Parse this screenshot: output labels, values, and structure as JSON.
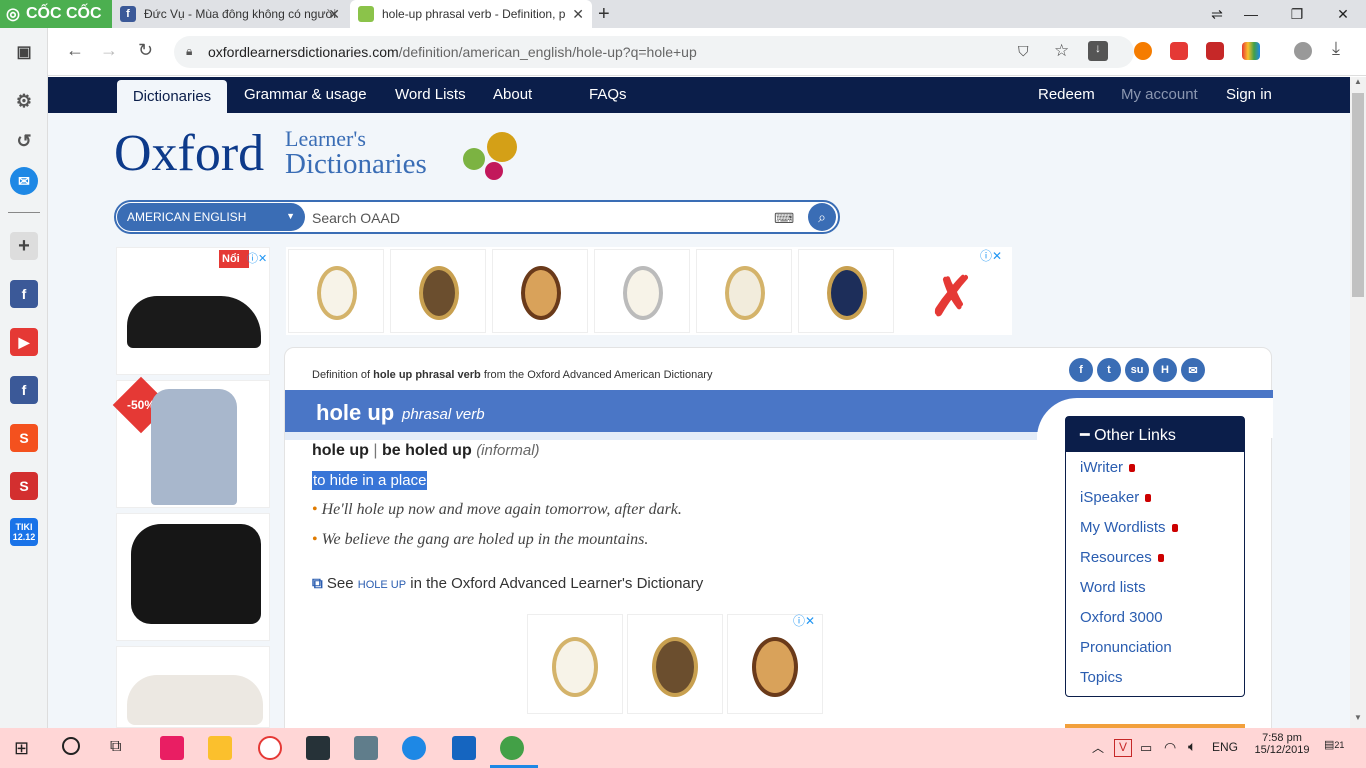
{
  "browser": {
    "brand": "CỐC CỐC",
    "tabs": [
      {
        "title": "Đức Vụ - Mùa đông không có người"
      },
      {
        "title": "hole-up phrasal verb - Definition, p"
      }
    ],
    "new_tab": "+",
    "url_host": "oxfordlearnersdictionaries.com",
    "url_path": "/definition/american_english/hole-up?q=hole+up"
  },
  "site": {
    "nav": [
      "Dictionaries",
      "Grammar & usage",
      "Word Lists",
      "About",
      "FAQs"
    ],
    "nav_right": [
      "Redeem",
      "My account",
      "Sign in"
    ],
    "logo_main": "Oxford",
    "logo_top": "Learner's",
    "logo_bottom": "Dictionaries",
    "search": {
      "dialect": "AMERICAN ENGLISH",
      "placeholder": "Search OAAD"
    }
  },
  "ads": {
    "left_badges": [
      "Nổi",
      "-50%"
    ]
  },
  "entry": {
    "breadcrumb_pre": "Definition of",
    "breadcrumb_term": "hole up phrasal verb",
    "breadcrumb_post": "from the Oxford Advanced American Dictionary",
    "headword": "hole up",
    "pos": "phrasal verb",
    "forms_a": "hole up",
    "forms_sep": "|",
    "forms_b": "be holed up",
    "register": "(informal)",
    "definition": "to hide in a place",
    "examples": [
      "He'll hole up now and move again tomorrow, after dark.",
      "We believe the gang are holed up in the mountains."
    ],
    "see_pre": "See",
    "see_term": "HOLE UP",
    "see_post": "in the Oxford Advanced Learner's Dictionary"
  },
  "other_links": {
    "title": "Other Links",
    "items": [
      {
        "label": "iWriter",
        "locked": true
      },
      {
        "label": "iSpeaker",
        "locked": true
      },
      {
        "label": "My Wordlists",
        "locked": true
      },
      {
        "label": "Resources",
        "locked": true
      },
      {
        "label": "Word lists",
        "locked": false
      },
      {
        "label": "Oxford 3000",
        "locked": false
      },
      {
        "label": "Pronunciation",
        "locked": false
      },
      {
        "label": "Topics",
        "locked": false
      }
    ]
  },
  "taskbar": {
    "lang": "ENG",
    "time": "7:58 pm",
    "date": "15/12/2019",
    "notif": "21"
  },
  "sidebar_badges": {
    "tiki": "TIKI",
    "tiki_date": "12.12"
  },
  "colors": {
    "navy": "#0b1e4a",
    "blue": "#4a76c6",
    "link": "#2a5db0",
    "accent": "#e07b00"
  }
}
